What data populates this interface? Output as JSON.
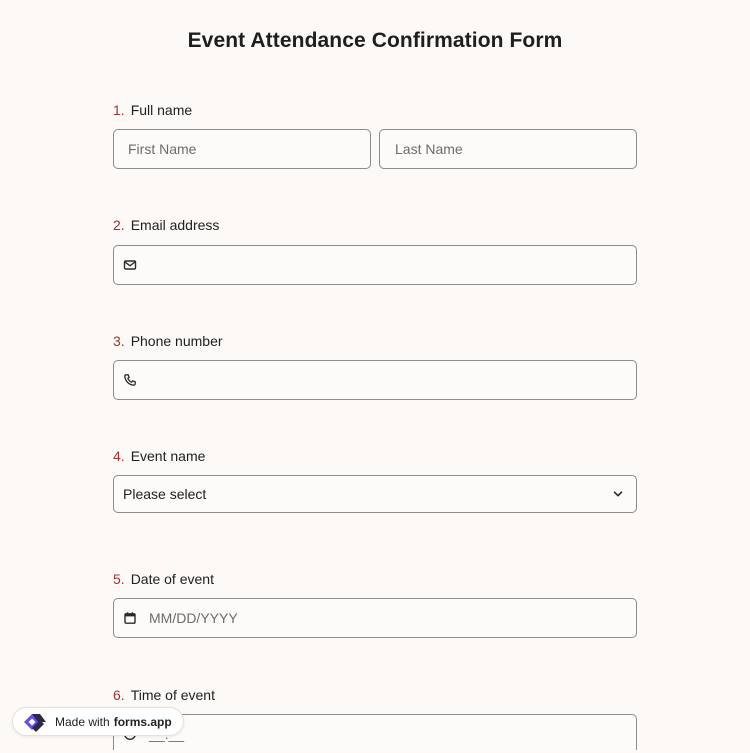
{
  "form": {
    "title": "Event Attendance Confirmation Form"
  },
  "questions": [
    {
      "number": "1.",
      "label": "Full name",
      "first_placeholder": "First Name",
      "last_placeholder": "Last Name"
    },
    {
      "number": "2.",
      "label": "Email address",
      "icon": "mail-icon"
    },
    {
      "number": "3.",
      "label": "Phone number",
      "icon": "phone-icon"
    },
    {
      "number": "4.",
      "label": "Event name",
      "selected": "Please select",
      "icon": "chevron-down-icon"
    },
    {
      "number": "5.",
      "label": "Date of event",
      "placeholder": "MM/DD/YYYY",
      "icon": "calendar-icon"
    },
    {
      "number": "6.",
      "label": "Time of event",
      "placeholder": "__:__",
      "icon": "clock-icon"
    }
  ],
  "footer": {
    "made_with": "Made with",
    "brand": "forms.app",
    "icon": "forms-app-logo-icon",
    "logo_colors": [
      "#6c4cf0",
      "#2b2b45"
    ]
  },
  "colors": {
    "background": "#fcf9f6",
    "question_number": "#a0352e",
    "border": "#8e8a87"
  }
}
